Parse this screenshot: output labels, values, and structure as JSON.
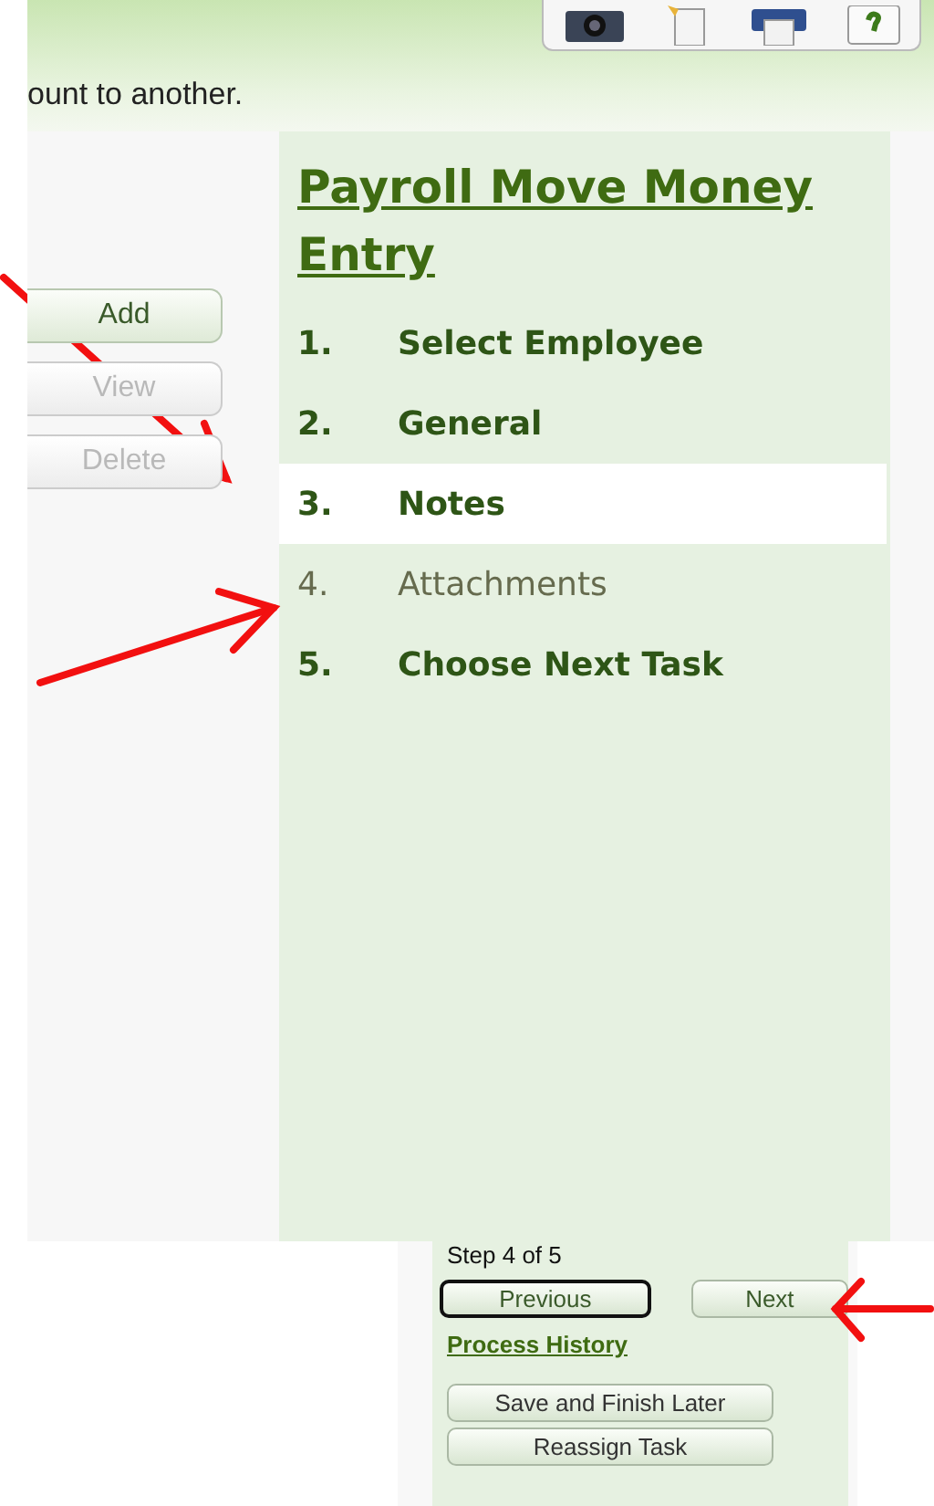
{
  "toolbar": {
    "icons": [
      {
        "kind": "camera"
      },
      {
        "kind": "document"
      },
      {
        "kind": "printer"
      },
      {
        "kind": "help"
      }
    ]
  },
  "description": "ount to another.",
  "actions": [
    {
      "label": "Add",
      "disabled": false
    },
    {
      "label": "View",
      "disabled": true
    },
    {
      "label": "Delete",
      "disabled": true
    }
  ],
  "wizard": {
    "title": "Payroll Move Money Entry",
    "steps": [
      {
        "number": "1.",
        "label": "Select Employee",
        "selected": false,
        "disabled": false
      },
      {
        "number": "2.",
        "label": "General",
        "selected": false,
        "disabled": false
      },
      {
        "number": "3.",
        "label": "Notes",
        "selected": true,
        "disabled": false
      },
      {
        "number": "4.",
        "label": "Attachments",
        "selected": false,
        "disabled": true
      },
      {
        "number": "5.",
        "label": "Choose Next Task",
        "selected": false,
        "disabled": false
      }
    ]
  },
  "navigation": {
    "step_text": "Step 4 of 5",
    "previous": "Previous",
    "next": "Next",
    "history_link": "Process History",
    "buttons": [
      "Save and Finish Later",
      "Reassign Task"
    ]
  }
}
